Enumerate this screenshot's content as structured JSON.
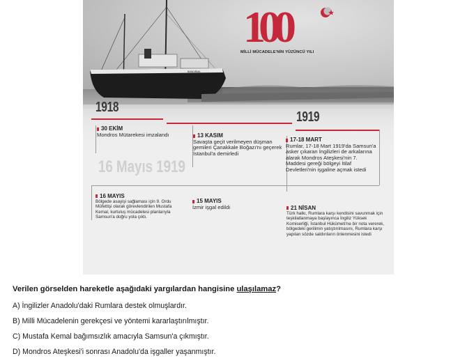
{
  "poster": {
    "logo_number": "100",
    "logo_subtitle": "MİLLİ MÜCADELE'NİN YÜZÜNCÜ YILI",
    "year_1918": "1918",
    "year_1919": "1919",
    "watermark": "16 Mayıs 1919",
    "events": [
      {
        "date": "30 EKİM",
        "text": "Mondros Mütarekesi imzalandı"
      },
      {
        "date": "13 KASIM",
        "text": "Savaşta geçit verilmeyen düşman gemileri Çanakkale Boğazı'nı geçerek İstanbul'a demirledi"
      },
      {
        "date": "17-18 MART",
        "text": "Rumlar, 17-18 Mart 1919'da Samsun'a asker çıkaran İngilizleri de arkalarına alarak Mondros Ateşkesi'nin 7. Maddesi gereği bölgeyi İtilaf Devletleri'nin işgaline açmak istedi"
      },
      {
        "date": "16 MAYIS",
        "text": "Bölgede asayişi sağlaması için 9. Ordu Müfettişi olarak görevlendirilen Mustafa Kemal, kurtuluş mücadelesi planlarıyla Samsun'a doğru yola çıktı."
      },
      {
        "date": "15 MAYIS",
        "text": "İzmir işgal edildi"
      },
      {
        "date": "21 NİSAN",
        "text": "Türk halkı, Rumlara karşı kendisini savunmak için teşkilatlanmaya başlayınca İngiliz Yüksek Komiserliği, İstanbul Hükümeti'ne bir nota vererek, bölgedeki gerilimin yatıştırılmasını, Rumlara karşı yapılan sözde saldırıların önlenmesini istedi"
      }
    ],
    "colors": {
      "accent_red": "#c4283a",
      "ship_hull": "#1c1c1c"
    }
  },
  "question": {
    "prefix": "Verilen görselden hareketle aşağıdaki yargılardan hangisine ",
    "underlined": "ulaşılamaz",
    "suffix": "?"
  },
  "options": [
    "A)  İngilizler Anadolu'daki Rumlara destek olmuşlardır.",
    "B)  Milli Mücadelenin gerekçesi ve yöntemi kararlaştırılmıştır.",
    "C)  Mustafa Kemal bağımsızlık amacıyla Samsun'a çıkmıştır.",
    "D)  Mondros Ateşkesi'i sonrası Anadolu'da işgaller yaşanmıştır."
  ]
}
